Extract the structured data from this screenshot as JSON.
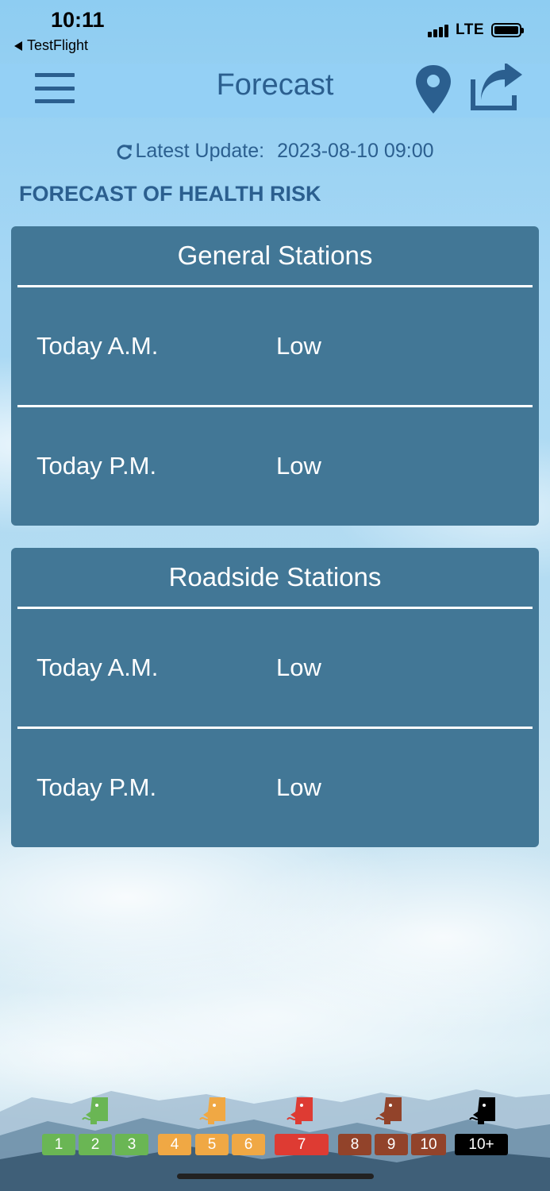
{
  "status_bar": {
    "time": "10:11",
    "back_app": "TestFlight",
    "network": "LTE"
  },
  "nav": {
    "title": "Forecast",
    "icons": [
      "menu-icon",
      "location-pin-icon",
      "share-icon"
    ]
  },
  "update": {
    "label": "Latest Update:",
    "value": "2023-08-10 09:00"
  },
  "section_heading": "FORECAST OF HEALTH RISK",
  "cards": [
    {
      "title": "General Stations",
      "rows": [
        {
          "period": "Today A.M.",
          "risk": "Low"
        },
        {
          "period": "Today P.M.",
          "risk": "Low"
        }
      ]
    },
    {
      "title": "Roadside Stations",
      "rows": [
        {
          "period": "Today A.M.",
          "risk": "Low"
        },
        {
          "period": "Today P.M.",
          "risk": "Low"
        }
      ]
    }
  ],
  "legend": {
    "levels": [
      "1",
      "2",
      "3",
      "4",
      "5",
      "6",
      "7",
      "8",
      "9",
      "10",
      "10+"
    ],
    "colors": {
      "low": "#6ab654",
      "moderate": "#f0a844",
      "high": "#de3b33",
      "very_high": "#92432a",
      "serious": "#000000"
    }
  },
  "colors": {
    "accent": "#2b5f8f",
    "card_bg": "#427796"
  }
}
